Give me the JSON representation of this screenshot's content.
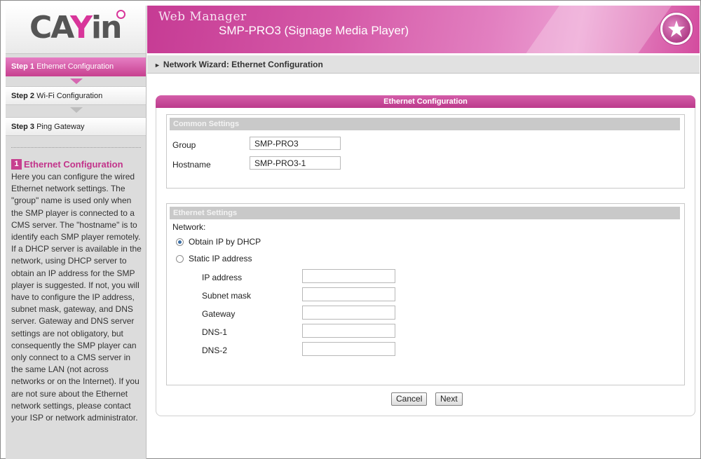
{
  "app": {
    "logo": "CAYIN",
    "header_title": "Web Manager",
    "header_subtitle": "SMP-PRO3 (Signage Media Player)"
  },
  "steps": [
    {
      "num": "Step 1",
      "label": "Ethernet Configuration",
      "active": true
    },
    {
      "num": "Step 2",
      "label": "Wi-Fi Configuration",
      "active": false
    },
    {
      "num": "Step 3",
      "label": "Ping Gateway",
      "active": false
    }
  ],
  "help": {
    "number": "1",
    "title": "Ethernet Configuration",
    "text": "Here you can configure the wired Ethernet network settings. The \"group\" name is used only when the SMP player is connected to a CMS server. The \"hostname\" is to identify each SMP player remotely. If a DHCP server is available in the network, using DHCP server to obtain an IP address for the SMP player is suggested. If not, you will have to configure the IP address, subnet mask, gateway, and DNS server. Gateway and DNS server settings are not obligatory, but consequently the SMP player can only connect to a CMS server in the same LAN (not across networks or on the Internet). If you are not sure about the Ethernet network settings, please contact your ISP or network administrator."
  },
  "breadcrumb": "Network Wizard: Ethernet Configuration",
  "panel": {
    "title": "Ethernet Configuration",
    "common": {
      "title": "Common Settings",
      "group_label": "Group",
      "group_value": "SMP-PRO3",
      "hostname_label": "Hostname",
      "hostname_value": "SMP-PRO3-1"
    },
    "ethernet": {
      "title": "Ethernet Settings",
      "network_label": "Network:",
      "dhcp_label": "Obtain IP by DHCP",
      "static_label": "Static IP address",
      "selected": "dhcp",
      "ip_label": "IP address",
      "ip_value": "",
      "subnet_label": "Subnet mask",
      "subnet_value": "",
      "gateway_label": "Gateway",
      "gateway_value": "",
      "dns1_label": "DNS-1",
      "dns1_value": "",
      "dns2_label": "DNS-2",
      "dns2_value": ""
    },
    "buttons": {
      "cancel": "Cancel",
      "next": "Next"
    }
  },
  "colors": {
    "accent": "#c7408f",
    "banner_light": "#ec9fd2"
  }
}
